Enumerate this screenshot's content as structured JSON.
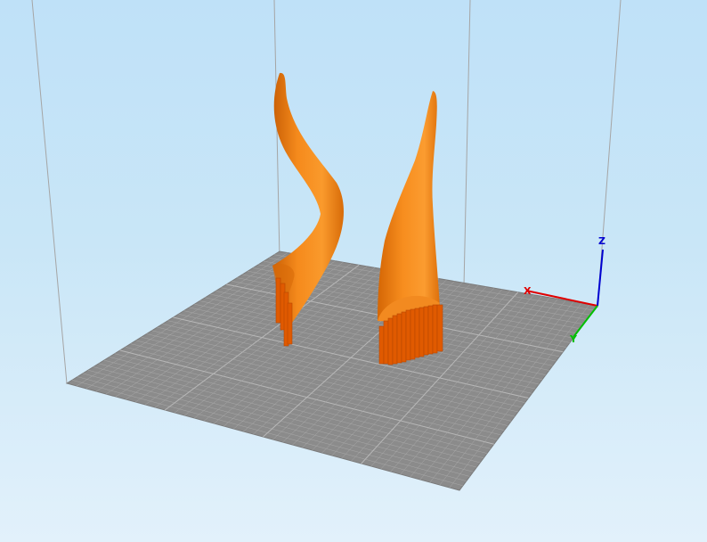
{
  "viewport": {
    "background_top": "#bfe1f8",
    "background_bottom": "#e2f1fb"
  },
  "bed": {
    "fill": "#8a8a8a",
    "grid_color": "#a9a9a9",
    "major_grid_color": "#b8b8b8"
  },
  "build_volume": {
    "edge_color": "#9a9a9a"
  },
  "models": [
    {
      "name": "left-horn",
      "color": "#f07b12",
      "support_color": "#e05a00"
    },
    {
      "name": "right-horn",
      "color": "#f07b12",
      "support_color": "#e05a00"
    }
  ],
  "axes": {
    "x": {
      "label": "X",
      "color": "#e00000"
    },
    "y": {
      "label": "Y",
      "color": "#00c000"
    },
    "z": {
      "label": "Z",
      "color": "#0000d0"
    }
  }
}
